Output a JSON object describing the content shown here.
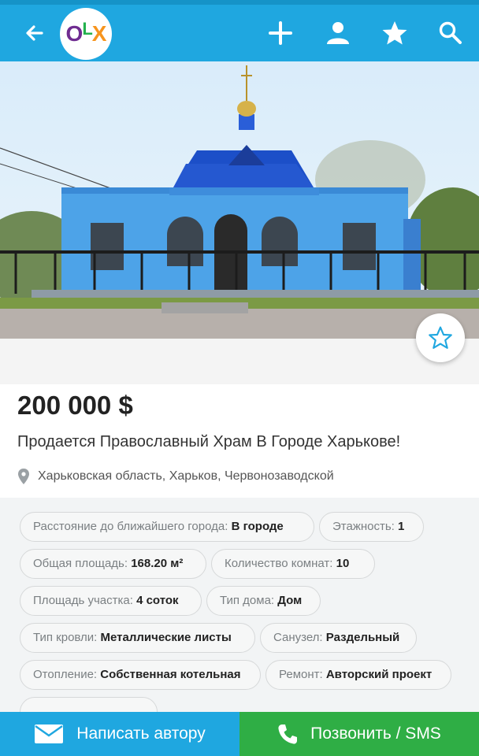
{
  "header": {
    "logo_text": "OLX",
    "icons": [
      "back-arrow-icon",
      "plus-icon",
      "user-icon",
      "star-icon",
      "search-icon"
    ]
  },
  "listing": {
    "price": "200 000 $",
    "title": "Продается Православный Храм В Городе Харькове!",
    "location": "Харьковская область, Харьков, Червонозаводской"
  },
  "params": [
    {
      "label": "Расстояние до ближайшего города:",
      "value": "В городе"
    },
    {
      "label": "Этажность:",
      "value": "1"
    },
    {
      "label": "Общая площадь:",
      "value": "168.20 м²"
    },
    {
      "label": "Количество комнат:",
      "value": "10"
    },
    {
      "label": "Площадь участка:",
      "value": "4 соток"
    },
    {
      "label": "Тип дома:",
      "value": "Дом"
    },
    {
      "label": "Тип кровли:",
      "value": "Металлические листы"
    },
    {
      "label": "Санузел:",
      "value": "Раздельный"
    },
    {
      "label": "Отопление:",
      "value": "Собственная котельная"
    },
    {
      "label": "Ремонт:",
      "value": "Авторский проект"
    }
  ],
  "actions": {
    "message_label": "Написать автору",
    "call_label": "Позвонить / SMS"
  },
  "colors": {
    "header": "#1fa7e0",
    "call_button": "#2fae45",
    "message_button": "#1fa7e0"
  }
}
